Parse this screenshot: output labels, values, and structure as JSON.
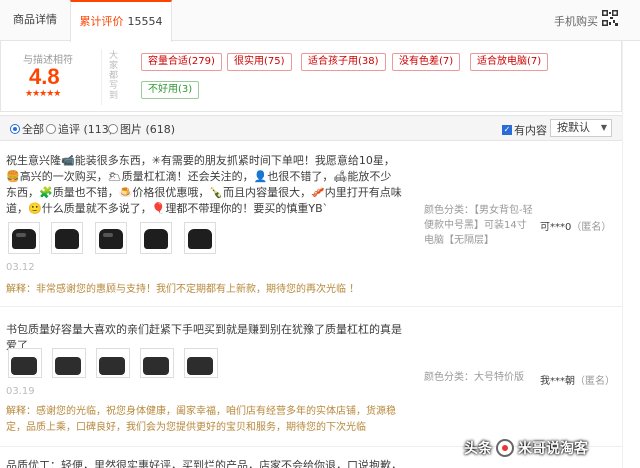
{
  "tabs": {
    "details_label": "商品详情",
    "reviews_label": "累计评价",
    "reviews_count": "15554",
    "mobile_buy": "手机购买"
  },
  "summary": {
    "score_label": "与描述相符",
    "score": "4.8",
    "stars": "★★★★★",
    "tag_heading": "大家都写到",
    "tags": [
      {
        "label": "容量合适(279)"
      },
      {
        "label": "很实用(75)"
      },
      {
        "label": "适合孩子用(38)"
      },
      {
        "label": "没有色差(7)"
      },
      {
        "label": "适合放电脑(7)"
      },
      {
        "label": "不好用(3)"
      }
    ]
  },
  "filters": {
    "all": "全部",
    "followup": "追评 (113)",
    "photos": "图片 (618)",
    "has_content": "有内容",
    "sort": "按默认"
  },
  "reviews": [
    {
      "text": "祝生意兴隆📹能装很多东西，✳有需要的朋友抓紧时间下单吧！我愿意给10星，🍔高兴的一次购买，🌥质量杠杠滴！还会关注的，👤也很不错了，🛋能放不少东西，🧩质量也不错，🍮价格很优惠哦，🍾而且内容量很大，🥓内里打开有点味道，🙂什么质量就不多说了，🎈理都不带理你的！要买的慎重YB`",
      "color_label": "颜色分类：【男女背包-轻便款中号黑】可装14寸电脑【无隔层】",
      "user": "可***0",
      "anon": "（匿名）",
      "date": "03.12",
      "reply": "解释：非常感谢您的惠顾与支持！我们不定期都有上新款，期待您的再次光临 ！"
    },
    {
      "text": "书包质量好容量大喜欢的亲们赶紧下手吧买到就是赚到别在犹豫了质量杠杠的真是爱了",
      "color_label": "颜色分类：大号特价版",
      "user": "我***朝",
      "anon": "（匿名）",
      "date": "03.19",
      "reply": "解释：感谢您的光临，祝您身体健康，阖家幸福，咱们店有经营多年的实体店铺，货源稳定，品质上乘，口碑良好，我们会为您提供更好的宝贝和服务，期待您的下次光临"
    },
    {
      "text": "品质优工：轻便，里然很实惠好评，买到烂的产品，店家不会给你退，口说抱歉，轻便的一次"
    }
  ],
  "watermark": {
    "prefix": "头条",
    "name": "米哥说淘客"
  }
}
